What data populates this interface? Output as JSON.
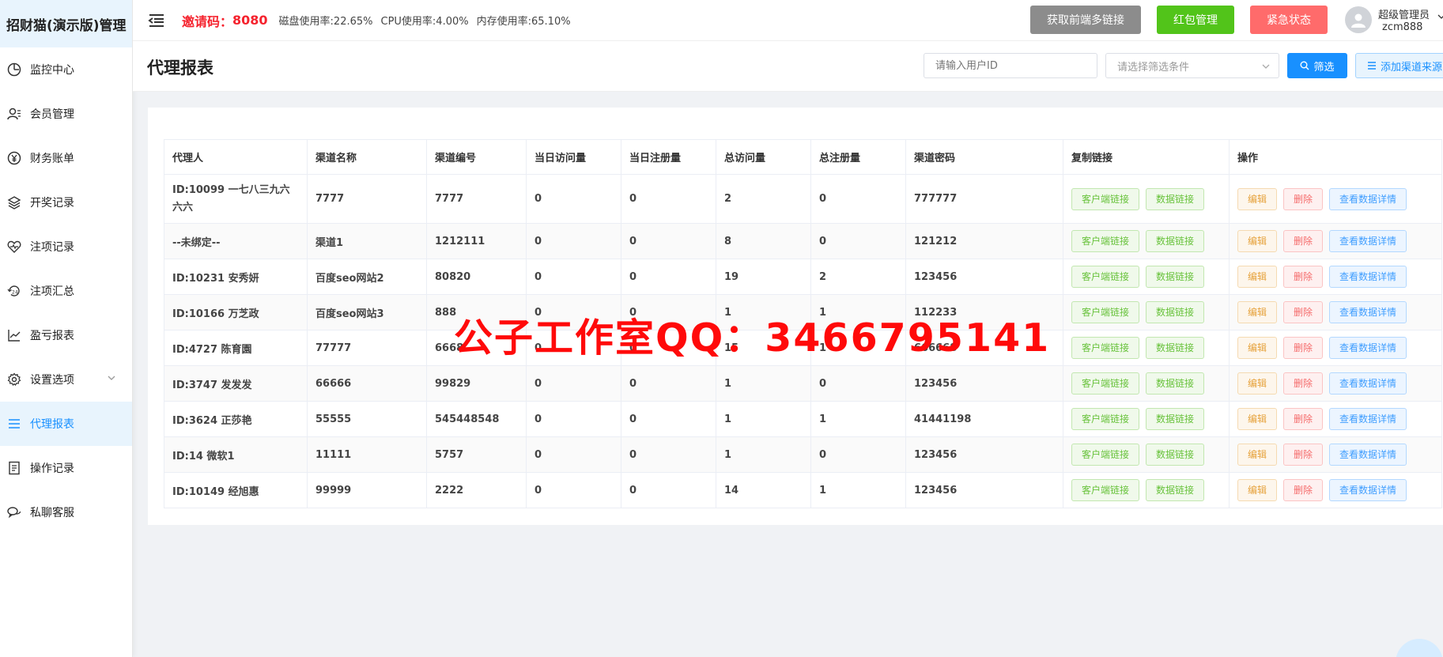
{
  "brand": {
    "title": "招财猫(演示版)管理"
  },
  "sidebar": {
    "items": [
      {
        "label": "监控中心",
        "icon": "dashboard-icon"
      },
      {
        "label": "会员管理",
        "icon": "users-icon"
      },
      {
        "label": "财务账单",
        "icon": "yen-icon"
      },
      {
        "label": "开奖记录",
        "icon": "layers-icon"
      },
      {
        "label": "注项记录",
        "icon": "heart-pulse-icon"
      },
      {
        "label": "注项汇总",
        "icon": "hours-24-icon"
      },
      {
        "label": "盈亏报表",
        "icon": "line-chart-icon"
      },
      {
        "label": "设置选项",
        "icon": "gear-icon"
      },
      {
        "label": "代理报表",
        "icon": "list-icon"
      },
      {
        "label": "操作记录",
        "icon": "document-icon"
      },
      {
        "label": "私聊客服",
        "icon": "chat-icon"
      }
    ],
    "active_index": 8
  },
  "header": {
    "invite_label": "邀请码：",
    "invite_code": "8080",
    "disk": "磁盘使用率:22.65%",
    "cpu": "CPU使用率:4.00%",
    "mem": "内存使用率:65.10%",
    "btn_links": "获取前端多链接",
    "btn_redpack": "红包管理",
    "btn_emergency": "紧急状态",
    "user_role": "超级管理员",
    "user_name": "zcm888"
  },
  "toolbar": {
    "title": "代理报表",
    "user_id_placeholder": "请输入用户ID",
    "filter_placeholder": "请选择筛选条件",
    "filter_btn": "筛选",
    "add_btn": "添加渠道来源"
  },
  "table": {
    "columns": [
      "代理人",
      "渠道名称",
      "渠道编号",
      "当日访问量",
      "当日注册量",
      "总访问量",
      "总注册量",
      "渠道密码",
      "复制链接",
      "操作"
    ],
    "action_labels": {
      "client_link": "客户端链接",
      "data_link": "数据链接",
      "edit": "编辑",
      "delete": "删除",
      "detail": "查看数据详情"
    },
    "rows": [
      {
        "agent": "ID:10099 一七八三九六六六",
        "name": "7777",
        "code": "7777",
        "today_visits": "0",
        "today_regs": "0",
        "total_visits": "2",
        "total_regs": "0",
        "password": "777777"
      },
      {
        "agent": "--未绑定--",
        "name": "渠道1",
        "code": "1212111",
        "today_visits": "0",
        "today_regs": "0",
        "total_visits": "8",
        "total_regs": "0",
        "password": "121212"
      },
      {
        "agent": "ID:10231 安秀妍",
        "name": "百度seo网站2",
        "code": "80820",
        "today_visits": "0",
        "today_regs": "0",
        "total_visits": "19",
        "total_regs": "2",
        "password": "123456"
      },
      {
        "agent": "ID:10166 万芝政",
        "name": "百度seo网站3",
        "code": "888",
        "today_visits": "0",
        "today_regs": "0",
        "total_visits": "1",
        "total_regs": "1",
        "password": "112233"
      },
      {
        "agent": "ID:4727 陈育園",
        "name": "77777",
        "code": "6668",
        "today_visits": "0",
        "today_regs": "0",
        "total_visits": "15",
        "total_regs": "1",
        "password": "666668"
      },
      {
        "agent": "ID:3747 发发发",
        "name": "66666",
        "code": "99829",
        "today_visits": "0",
        "today_regs": "0",
        "total_visits": "1",
        "total_regs": "0",
        "password": "123456"
      },
      {
        "agent": "ID:3624 正莎艳",
        "name": "55555",
        "code": "545448548",
        "today_visits": "0",
        "today_regs": "0",
        "total_visits": "1",
        "total_regs": "1",
        "password": "41441198"
      },
      {
        "agent": "ID:14 微软1",
        "name": "11111",
        "code": "5757",
        "today_visits": "0",
        "today_regs": "0",
        "total_visits": "1",
        "total_regs": "0",
        "password": "123456"
      },
      {
        "agent": "ID:10149 经旭惠",
        "name": "99999",
        "code": "2222",
        "today_visits": "0",
        "today_regs": "0",
        "total_visits": "14",
        "total_regs": "1",
        "password": "123456"
      }
    ]
  },
  "watermark": {
    "text": "公子工作室QQ：3466795141"
  },
  "colors": {
    "accent": "#1890ff",
    "invite": "#f5222d",
    "watermark": "#ff0a0a",
    "btn_gray": "#8c8c8c",
    "btn_green": "#52c41a",
    "btn_red": "#ff6b6b"
  }
}
